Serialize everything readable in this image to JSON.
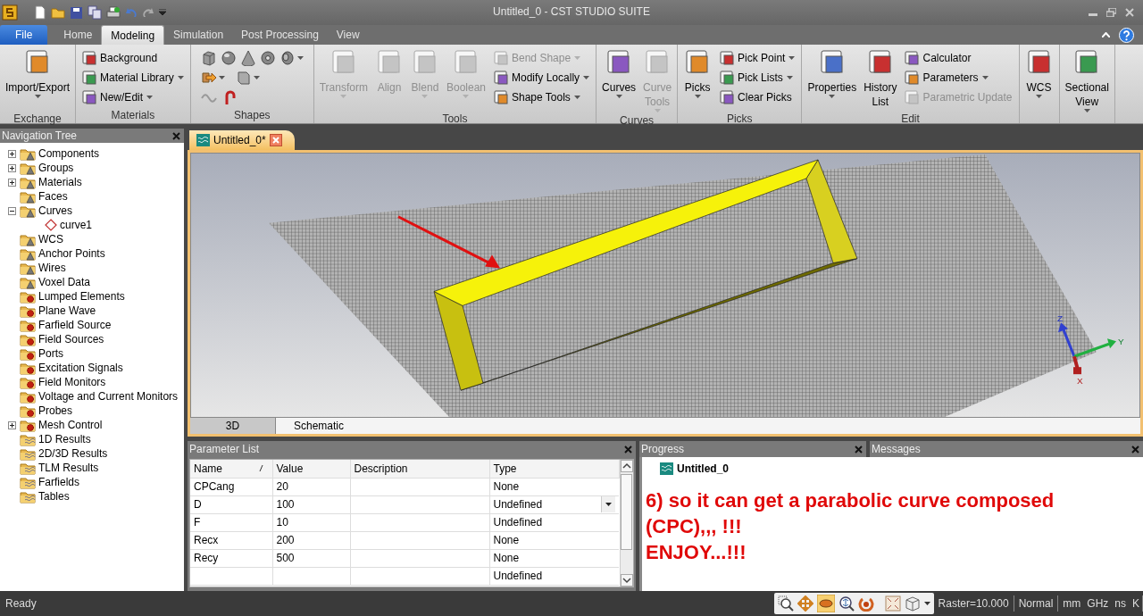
{
  "window": {
    "title": "Untitled_0 - CST STUDIO SUITE"
  },
  "ribbon_tabs": [
    {
      "label": "File",
      "kind": "file",
      "selected": false
    },
    {
      "label": "Home",
      "kind": "tab",
      "selected": false
    },
    {
      "label": "Modeling",
      "kind": "tab",
      "selected": true
    },
    {
      "label": "Simulation",
      "kind": "tab",
      "selected": false
    },
    {
      "label": "Post Processing",
      "kind": "tab",
      "selected": false
    },
    {
      "label": "View",
      "kind": "tab",
      "selected": false
    }
  ],
  "ribbon_groups": [
    {
      "label": "Exchange",
      "kind": "buttons",
      "items": [
        {
          "kind": "large",
          "label": "Import/Export",
          "disabled": false,
          "dropdown": true
        }
      ]
    },
    {
      "label": "Materials",
      "kind": "buttons",
      "items": [
        {
          "kind": "small",
          "label": "Background",
          "disabled": false,
          "dropdown": false
        },
        {
          "kind": "small",
          "label": "Material Library",
          "disabled": false,
          "dropdown": true
        },
        {
          "kind": "small",
          "label": "New/Edit",
          "disabled": false,
          "dropdown": true
        }
      ]
    },
    {
      "label": "Shapes",
      "kind": "shapes"
    },
    {
      "label": "Tools",
      "kind": "buttons",
      "items": [
        {
          "kind": "large",
          "label": "Transform",
          "disabled": true,
          "dropdown": true
        },
        {
          "kind": "large",
          "label": "Align",
          "disabled": true,
          "dropdown": false
        },
        {
          "kind": "large",
          "label": "Blend",
          "disabled": true,
          "dropdown": true
        },
        {
          "kind": "large",
          "label": "Boolean",
          "disabled": true,
          "dropdown": true
        },
        {
          "kind": "small",
          "label": "Bend Shape",
          "disabled": true,
          "dropdown": true
        },
        {
          "kind": "small",
          "label": "Modify Locally",
          "disabled": false,
          "dropdown": true
        },
        {
          "kind": "small",
          "label": "Shape Tools",
          "disabled": false,
          "dropdown": true
        }
      ]
    },
    {
      "label": "Curves",
      "kind": "buttons",
      "items": [
        {
          "kind": "large",
          "label": "Curves",
          "disabled": false,
          "dropdown": true
        },
        {
          "kind": "large",
          "label": "Curve Tools",
          "disabled": true,
          "dropdown": true
        }
      ]
    },
    {
      "label": "Picks",
      "kind": "buttons",
      "items": [
        {
          "kind": "large",
          "label": "Picks",
          "disabled": false,
          "dropdown": true
        },
        {
          "kind": "small",
          "label": "Pick Point",
          "disabled": false,
          "dropdown": true
        },
        {
          "kind": "small",
          "label": "Pick Lists",
          "disabled": false,
          "dropdown": true
        },
        {
          "kind": "small",
          "label": "Clear Picks",
          "disabled": false,
          "dropdown": false
        }
      ]
    },
    {
      "label": "Edit",
      "kind": "buttons",
      "items": [
        {
          "kind": "large",
          "label": "Properties",
          "disabled": false,
          "dropdown": true
        },
        {
          "kind": "large",
          "label": "History List",
          "disabled": false,
          "dropdown": false
        },
        {
          "kind": "small",
          "label": "Calculator",
          "disabled": false,
          "dropdown": false
        },
        {
          "kind": "small",
          "label": "Parameters",
          "disabled": false,
          "dropdown": true
        },
        {
          "kind": "small",
          "label": "Parametric Update",
          "disabled": true,
          "dropdown": false
        }
      ]
    },
    {
      "kind": "buttons",
      "items": [
        {
          "kind": "large",
          "label": "WCS",
          "disabled": false,
          "dropdown": true
        }
      ]
    },
    {
      "kind": "buttons",
      "items": [
        {
          "kind": "large",
          "label": "Sectional View",
          "disabled": false,
          "dropdown": true
        }
      ]
    }
  ],
  "navigation_tree": {
    "title": "Navigation Tree",
    "items": [
      {
        "label": "Components",
        "kind": "folder",
        "expanded": false
      },
      {
        "label": "Groups",
        "kind": "folder",
        "expanded": false
      },
      {
        "label": "Materials",
        "kind": "folder",
        "expanded": false
      },
      {
        "label": "Faces",
        "kind": "folder"
      },
      {
        "label": "Curves",
        "kind": "folder",
        "expanded": true,
        "children": [
          {
            "label": "curve1",
            "kind": "curve"
          }
        ]
      },
      {
        "label": "WCS",
        "kind": "folder"
      },
      {
        "label": "Anchor Points",
        "kind": "folder"
      },
      {
        "label": "Wires",
        "kind": "folder"
      },
      {
        "label": "Voxel Data",
        "kind": "folder"
      },
      {
        "label": "Lumped Elements",
        "kind": "source"
      },
      {
        "label": "Plane Wave",
        "kind": "source"
      },
      {
        "label": "Farfield Source",
        "kind": "source"
      },
      {
        "label": "Field Sources",
        "kind": "source"
      },
      {
        "label": "Ports",
        "kind": "source"
      },
      {
        "label": "Excitation Signals",
        "kind": "source"
      },
      {
        "label": "Field Monitors",
        "kind": "source"
      },
      {
        "label": "Voltage and Current Monitors",
        "kind": "source"
      },
      {
        "label": "Probes",
        "kind": "source"
      },
      {
        "label": "Mesh Control",
        "kind": "source",
        "expanded": false
      },
      {
        "label": "1D Results",
        "kind": "results"
      },
      {
        "label": "2D/3D Results",
        "kind": "results"
      },
      {
        "label": "TLM Results",
        "kind": "results"
      },
      {
        "label": "Farfields",
        "kind": "results"
      },
      {
        "label": "Tables",
        "kind": "results"
      }
    ]
  },
  "document_tab": {
    "label": "Untitled_0*"
  },
  "viewport": {
    "axes": {
      "x": "X",
      "y": "Y",
      "z": "Z"
    }
  },
  "view_tabs": [
    {
      "label": "3D",
      "selected": true
    },
    {
      "label": "Schematic",
      "selected": false
    }
  ],
  "parameter_list": {
    "title": "Parameter List",
    "columns": [
      {
        "label": "Name",
        "sorted": true
      },
      {
        "label": "Value",
        "sorted": false
      },
      {
        "label": "Description",
        "sorted": false
      },
      {
        "label": "Type",
        "sorted": false
      }
    ],
    "rows": [
      {
        "name": "CPCang",
        "value": "20",
        "type": "None",
        "selected": false
      },
      {
        "name": "D",
        "value": "100",
        "type": "Undefined",
        "selected": true
      },
      {
        "name": "F",
        "value": "10",
        "type": "Undefined",
        "selected": false
      },
      {
        "name": "Recx",
        "value": "200",
        "type": "None",
        "selected": false
      },
      {
        "name": "Recy",
        "value": "500",
        "type": "None",
        "selected": false
      },
      {
        "type": "Undefined",
        "selected": false
      }
    ]
  },
  "progress": {
    "title": "Progress",
    "item": "Untitled_0"
  },
  "messages": {
    "title": "Messages"
  },
  "annotation": [
    "6) so it can get a parabolic curve composed",
    "(CPC),,, !!!",
    "ENJOY...!!!"
  ],
  "status_bar": {
    "status": "Ready",
    "raster": "Raster=10.000",
    "mode": "Normal",
    "units": [
      "mm",
      "GHz",
      "ns",
      "K"
    ]
  }
}
